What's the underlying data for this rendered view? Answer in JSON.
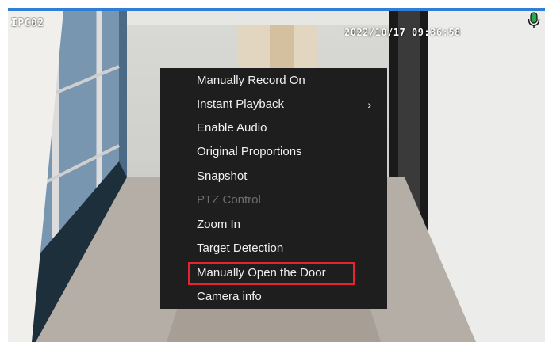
{
  "camera": {
    "name": "IPC02",
    "timestamp": "2022/10/17 09:36:58"
  },
  "icons": {
    "mic": "microphone-icon",
    "submenu": "chevron-right-icon"
  },
  "colors": {
    "highlight": "#e5242b",
    "menu_bg": "#1e1e1e",
    "top_bar": "#2f7fd6"
  },
  "context_menu": {
    "items": [
      {
        "label": "Manually Record On",
        "enabled": true
      },
      {
        "label": "Instant Playback",
        "enabled": true,
        "submenu": true,
        "chevron": "›"
      },
      {
        "label": "Enable Audio",
        "enabled": true
      },
      {
        "label": "Original Proportions",
        "enabled": true
      },
      {
        "label": "Snapshot",
        "enabled": true
      },
      {
        "label": "PTZ Control",
        "enabled": false
      },
      {
        "label": "Zoom In",
        "enabled": true
      },
      {
        "label": "Target Detection",
        "enabled": true
      },
      {
        "label": "Manually Open the Door",
        "enabled": true,
        "highlighted": true
      },
      {
        "label": "Camera info",
        "enabled": true
      }
    ]
  }
}
